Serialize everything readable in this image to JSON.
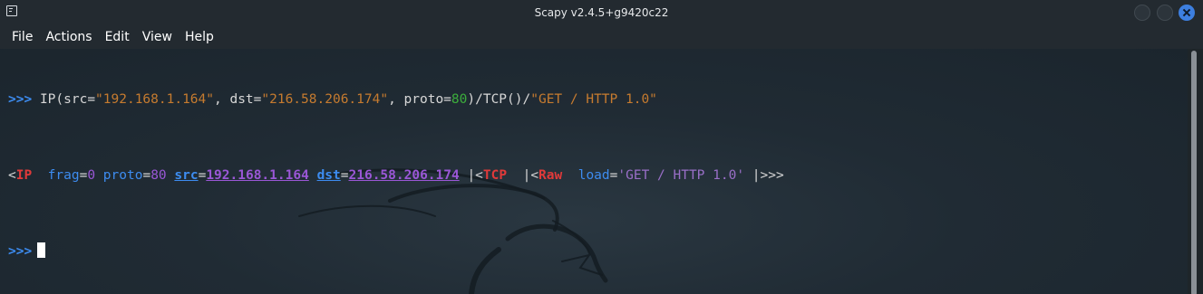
{
  "window": {
    "title": "Scapy v2.4.5+g9420c22",
    "app_icon": "terminal-icon",
    "controls": [
      "minimize",
      "maximize",
      "close"
    ],
    "accent_color": "#3d7fe0"
  },
  "menu": {
    "items": [
      "File",
      "Actions",
      "Edit",
      "View",
      "Help"
    ]
  },
  "terminal": {
    "prompt": ">>>",
    "line1": {
      "a": "IP(src=",
      "b": "\"192.168.1.164\"",
      "c": ", dst=",
      "d": "\"216.58.206.174\"",
      "e": ", proto=",
      "f": "80",
      "g": ")/TCP()/",
      "h": "\"GET / HTTP 1.0\""
    },
    "line2": {
      "open1": "<",
      "layer_ip": "IP",
      "sp1": "  ",
      "frag_key": "frag",
      "eq1": "=",
      "frag_val": "0",
      "sp2": " ",
      "proto_key": "proto",
      "eq2": "=",
      "proto_val": "80",
      "sp3": " ",
      "src_key": "src",
      "eq3": "=",
      "src_val": "192.168.1.164",
      "sp4": " ",
      "dst_key": "dst",
      "eq4": "=",
      "dst_val": "216.58.206.174",
      "sep1": " |<",
      "layer_tcp": "TCP",
      "sep2": "  |<",
      "layer_raw": "Raw",
      "sp5": "  ",
      "load_key": "load",
      "eq5": "=",
      "load_val": "'GET / HTTP 1.0'",
      "end": " |>>>"
    },
    "colors": {
      "prompt": "#3d8cf0",
      "string": "#c67b2f",
      "number": "#3cae3c",
      "layer": "#e03a3a",
      "field": "#3d8cf0",
      "value": "#9a57d6"
    }
  }
}
